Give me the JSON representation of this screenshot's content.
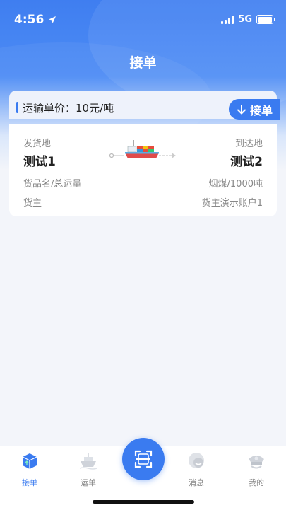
{
  "status_bar": {
    "time": "4:56",
    "network": "5G"
  },
  "header": {
    "title": "接单"
  },
  "price": {
    "label": "运输单价：10元/吨"
  },
  "take_button": {
    "label": "接单"
  },
  "order": {
    "origin_label": "发货地",
    "origin_value": "测试1",
    "dest_label": "到达地",
    "dest_value": "测试2",
    "goods_label": "货品名/总运量",
    "goods_value": "烟煤/1000吨",
    "owner_label": "货主",
    "owner_value": "货主演示账户1"
  },
  "tabbar": {
    "items": [
      {
        "label": "接单",
        "icon": "order-box-icon",
        "active": true
      },
      {
        "label": "运单",
        "icon": "ship-icon",
        "active": false
      },
      {
        "label": "",
        "icon": "scan-icon",
        "active": false
      },
      {
        "label": "消息",
        "icon": "message-icon",
        "active": false
      },
      {
        "label": "我的",
        "icon": "captain-hat-icon",
        "active": false
      }
    ]
  },
  "colors": {
    "primary": "#3a7bf0",
    "background": "#f3f5fa"
  }
}
